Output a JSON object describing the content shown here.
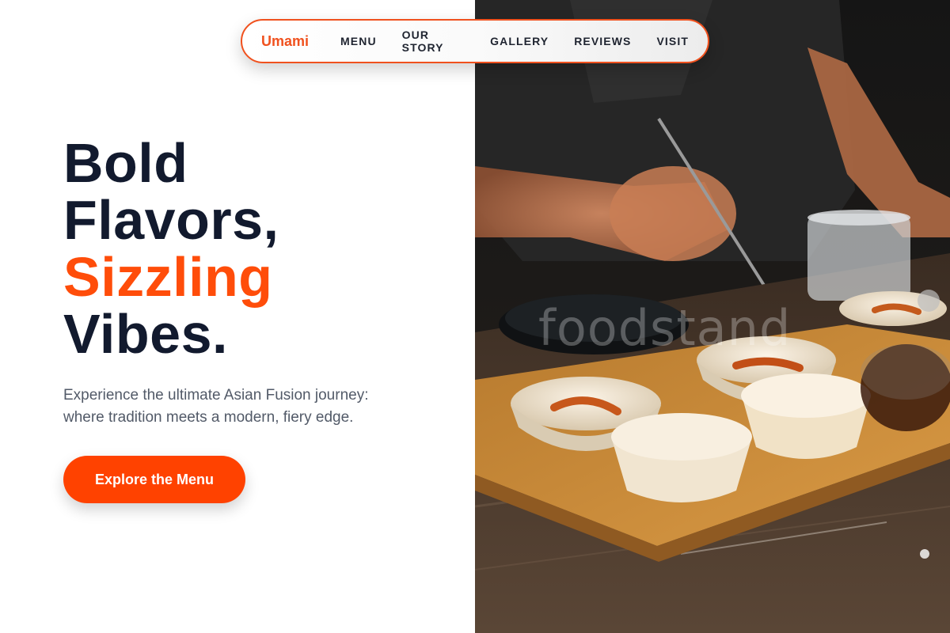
{
  "brand": {
    "name": "Umami",
    "color": "#f0511e"
  },
  "nav": {
    "items": [
      {
        "label": "MENU"
      },
      {
        "label": "OUR STORY"
      },
      {
        "label": "GALLERY"
      },
      {
        "label": "REVIEWS"
      },
      {
        "label": "VISIT"
      }
    ]
  },
  "hero": {
    "headline": {
      "line1": "Bold",
      "line2": "Flavors,",
      "line3": "Sizzling",
      "line4": "Vibes."
    },
    "subtext": "Experience the ultimate Asian Fusion journey: where tradition meets a modern, fiery edge.",
    "cta_label": "Explore the Menu",
    "photo": {
      "watermark": "foodstand",
      "subject": "chef-plating-dishes-on-wooden-tray"
    }
  },
  "colors": {
    "accent": "#ff4d0a",
    "heading": "#121a2e",
    "body_text": "#525a68",
    "cta_bg": "#ff4200"
  }
}
